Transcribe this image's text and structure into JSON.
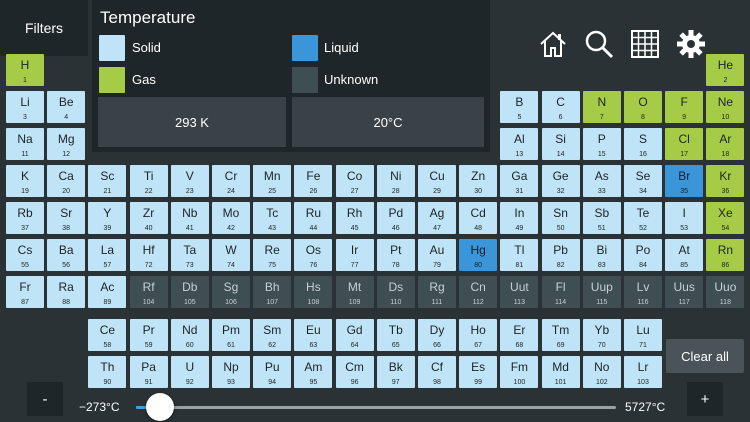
{
  "colors": {
    "solid": "#bfe3f7",
    "gas": "#a6cc47",
    "liquid": "#3a95d9",
    "unknown": "#3f4e51"
  },
  "toolbar": {
    "filters_label": "Filters",
    "home_icon": "home-icon",
    "search_icon": "search-icon",
    "grid_icon": "grid-icon",
    "settings_icon": "gear-icon"
  },
  "panel": {
    "title": "Temperature",
    "legend": [
      {
        "label": "Solid",
        "state": "solid"
      },
      {
        "label": "Liquid",
        "state": "liquid"
      },
      {
        "label": "Gas",
        "state": "gas"
      },
      {
        "label": "Unknown",
        "state": "unknown"
      }
    ],
    "kelvin": "293 K",
    "celsius": "20°C"
  },
  "controls": {
    "clear_label": "Clear all",
    "minus_label": "-",
    "plus_label": "+",
    "min_label": "−273°C",
    "max_label": "5727°C",
    "slider_fraction": 0.049
  },
  "elements": [
    [
      "H",
      1,
      "gas",
      0,
      0
    ],
    [
      "He",
      2,
      "gas",
      17,
      0
    ],
    [
      "Li",
      3,
      "solid",
      0,
      1
    ],
    [
      "Be",
      4,
      "solid",
      1,
      1
    ],
    [
      "B",
      5,
      "solid",
      12,
      1
    ],
    [
      "C",
      6,
      "solid",
      13,
      1
    ],
    [
      "N",
      7,
      "gas",
      14,
      1
    ],
    [
      "O",
      8,
      "gas",
      15,
      1
    ],
    [
      "F",
      9,
      "gas",
      16,
      1
    ],
    [
      "Ne",
      10,
      "gas",
      17,
      1
    ],
    [
      "Na",
      11,
      "solid",
      0,
      2
    ],
    [
      "Mg",
      12,
      "solid",
      1,
      2
    ],
    [
      "Al",
      13,
      "solid",
      12,
      2
    ],
    [
      "Si",
      14,
      "solid",
      13,
      2
    ],
    [
      "P",
      15,
      "solid",
      14,
      2
    ],
    [
      "S",
      16,
      "solid",
      15,
      2
    ],
    [
      "Cl",
      17,
      "gas",
      16,
      2
    ],
    [
      "Ar",
      18,
      "gas",
      17,
      2
    ],
    [
      "K",
      19,
      "solid",
      0,
      3
    ],
    [
      "Ca",
      20,
      "solid",
      1,
      3
    ],
    [
      "Sc",
      21,
      "solid",
      2,
      3
    ],
    [
      "Ti",
      22,
      "solid",
      3,
      3
    ],
    [
      "V",
      23,
      "solid",
      4,
      3
    ],
    [
      "Cr",
      24,
      "solid",
      5,
      3
    ],
    [
      "Mn",
      25,
      "solid",
      6,
      3
    ],
    [
      "Fe",
      26,
      "solid",
      7,
      3
    ],
    [
      "Co",
      27,
      "solid",
      8,
      3
    ],
    [
      "Ni",
      28,
      "solid",
      9,
      3
    ],
    [
      "Cu",
      29,
      "solid",
      10,
      3
    ],
    [
      "Zn",
      30,
      "solid",
      11,
      3
    ],
    [
      "Ga",
      31,
      "solid",
      12,
      3
    ],
    [
      "Ge",
      32,
      "solid",
      13,
      3
    ],
    [
      "As",
      33,
      "solid",
      14,
      3
    ],
    [
      "Se",
      34,
      "solid",
      15,
      3
    ],
    [
      "Br",
      35,
      "liquid",
      16,
      3
    ],
    [
      "Kr",
      36,
      "gas",
      17,
      3
    ],
    [
      "Rb",
      37,
      "solid",
      0,
      4
    ],
    [
      "Sr",
      38,
      "solid",
      1,
      4
    ],
    [
      "Y",
      39,
      "solid",
      2,
      4
    ],
    [
      "Zr",
      40,
      "solid",
      3,
      4
    ],
    [
      "Nb",
      41,
      "solid",
      4,
      4
    ],
    [
      "Mo",
      42,
      "solid",
      5,
      4
    ],
    [
      "Tc",
      43,
      "solid",
      6,
      4
    ],
    [
      "Ru",
      44,
      "solid",
      7,
      4
    ],
    [
      "Rh",
      45,
      "solid",
      8,
      4
    ],
    [
      "Pd",
      46,
      "solid",
      9,
      4
    ],
    [
      "Ag",
      47,
      "solid",
      10,
      4
    ],
    [
      "Cd",
      48,
      "solid",
      11,
      4
    ],
    [
      "In",
      49,
      "solid",
      12,
      4
    ],
    [
      "Sn",
      50,
      "solid",
      13,
      4
    ],
    [
      "Sb",
      51,
      "solid",
      14,
      4
    ],
    [
      "Te",
      52,
      "solid",
      15,
      4
    ],
    [
      "I",
      53,
      "solid",
      16,
      4
    ],
    [
      "Xe",
      54,
      "gas",
      17,
      4
    ],
    [
      "Cs",
      55,
      "solid",
      0,
      5
    ],
    [
      "Ba",
      56,
      "solid",
      1,
      5
    ],
    [
      "La",
      57,
      "solid",
      2,
      5
    ],
    [
      "Hf",
      72,
      "solid",
      3,
      5
    ],
    [
      "Ta",
      73,
      "solid",
      4,
      5
    ],
    [
      "W",
      74,
      "solid",
      5,
      5
    ],
    [
      "Re",
      75,
      "solid",
      6,
      5
    ],
    [
      "Os",
      76,
      "solid",
      7,
      5
    ],
    [
      "Ir",
      77,
      "solid",
      8,
      5
    ],
    [
      "Pt",
      78,
      "solid",
      9,
      5
    ],
    [
      "Au",
      79,
      "solid",
      10,
      5
    ],
    [
      "Hg",
      80,
      "liquid",
      11,
      5
    ],
    [
      "Tl",
      81,
      "solid",
      12,
      5
    ],
    [
      "Pb",
      82,
      "solid",
      13,
      5
    ],
    [
      "Bi",
      83,
      "solid",
      14,
      5
    ],
    [
      "Po",
      84,
      "solid",
      15,
      5
    ],
    [
      "At",
      85,
      "solid",
      16,
      5
    ],
    [
      "Rn",
      86,
      "gas",
      17,
      5
    ],
    [
      "Fr",
      87,
      "solid",
      0,
      6
    ],
    [
      "Ra",
      88,
      "solid",
      1,
      6
    ],
    [
      "Ac",
      89,
      "solid",
      2,
      6
    ],
    [
      "Rf",
      104,
      "unknown",
      3,
      6
    ],
    [
      "Db",
      105,
      "unknown",
      4,
      6
    ],
    [
      "Sg",
      106,
      "unknown",
      5,
      6
    ],
    [
      "Bh",
      107,
      "unknown",
      6,
      6
    ],
    [
      "Hs",
      108,
      "unknown",
      7,
      6
    ],
    [
      "Mt",
      109,
      "unknown",
      8,
      6
    ],
    [
      "Ds",
      110,
      "unknown",
      9,
      6
    ],
    [
      "Rg",
      111,
      "unknown",
      10,
      6
    ],
    [
      "Cn",
      112,
      "unknown",
      11,
      6
    ],
    [
      "Uut",
      113,
      "unknown",
      12,
      6
    ],
    [
      "Fl",
      114,
      "unknown",
      13,
      6
    ],
    [
      "Uup",
      115,
      "unknown",
      14,
      6
    ],
    [
      "Lv",
      116,
      "unknown",
      15,
      6
    ],
    [
      "Uus",
      117,
      "unknown",
      16,
      6
    ],
    [
      "Uuo",
      118,
      "unknown",
      17,
      6
    ],
    [
      "Ce",
      58,
      "solid",
      2,
      7
    ],
    [
      "Pr",
      59,
      "solid",
      3,
      7
    ],
    [
      "Nd",
      60,
      "solid",
      4,
      7
    ],
    [
      "Pm",
      61,
      "solid",
      5,
      7
    ],
    [
      "Sm",
      62,
      "solid",
      6,
      7
    ],
    [
      "Eu",
      63,
      "solid",
      7,
      7
    ],
    [
      "Gd",
      64,
      "solid",
      8,
      7
    ],
    [
      "Tb",
      65,
      "solid",
      9,
      7
    ],
    [
      "Dy",
      66,
      "solid",
      10,
      7
    ],
    [
      "Ho",
      67,
      "solid",
      11,
      7
    ],
    [
      "Er",
      68,
      "solid",
      12,
      7
    ],
    [
      "Tm",
      69,
      "solid",
      13,
      7
    ],
    [
      "Yb",
      70,
      "solid",
      14,
      7
    ],
    [
      "Lu",
      71,
      "solid",
      15,
      7
    ],
    [
      "Th",
      90,
      "solid",
      2,
      8
    ],
    [
      "Pa",
      91,
      "solid",
      3,
      8
    ],
    [
      "U",
      92,
      "solid",
      4,
      8
    ],
    [
      "Np",
      93,
      "solid",
      5,
      8
    ],
    [
      "Pu",
      94,
      "solid",
      6,
      8
    ],
    [
      "Am",
      95,
      "solid",
      7,
      8
    ],
    [
      "Cm",
      96,
      "solid",
      8,
      8
    ],
    [
      "Bk",
      97,
      "solid",
      9,
      8
    ],
    [
      "Cf",
      98,
      "solid",
      10,
      8
    ],
    [
      "Es",
      99,
      "solid",
      11,
      8
    ],
    [
      "Fm",
      100,
      "solid",
      12,
      8
    ],
    [
      "Md",
      101,
      "solid",
      13,
      8
    ],
    [
      "No",
      102,
      "solid",
      14,
      8
    ],
    [
      "Lr",
      103,
      "solid",
      15,
      8
    ]
  ]
}
